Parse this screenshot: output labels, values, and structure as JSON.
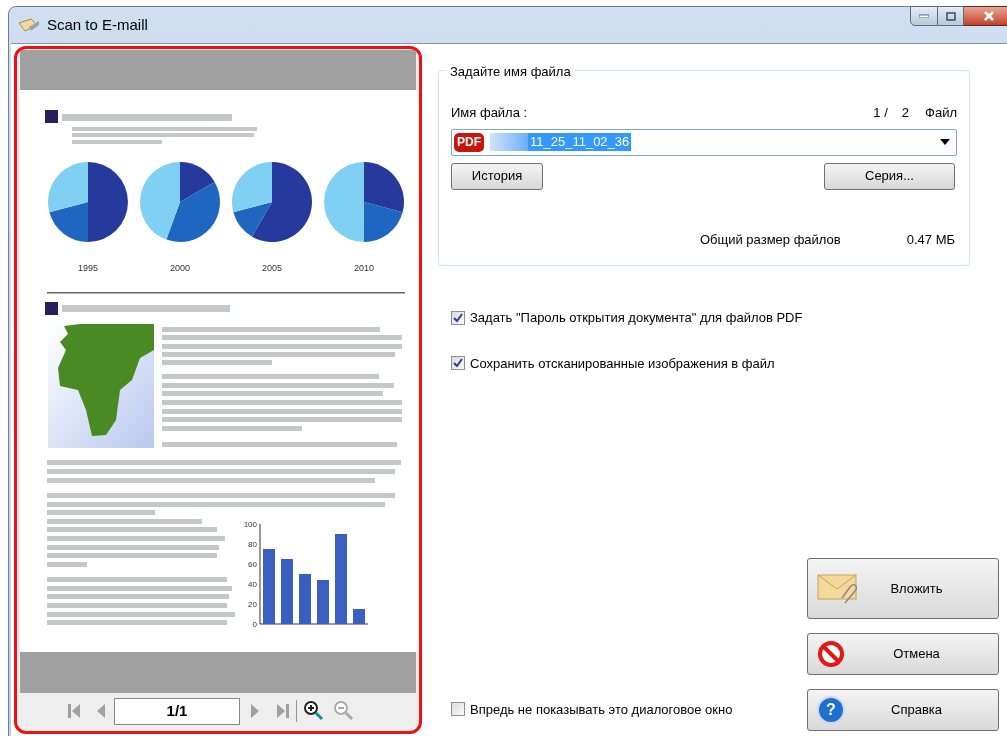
{
  "window": {
    "title": "Scan to E-maill"
  },
  "preview": {
    "pie_labels": [
      "1995",
      "2000",
      "2005",
      "2010"
    ],
    "chart_data": {
      "type": "bar",
      "values": [
        75,
        65,
        50,
        44,
        90,
        15
      ],
      "ylim": [
        0,
        100
      ],
      "yticks": [
        0,
        20,
        40,
        60,
        80,
        100
      ]
    },
    "page_indicator": "1/1"
  },
  "file_group": {
    "title": "Задайте имя файла",
    "filename_label": "Имя файла :",
    "page_current": "1 /",
    "page_total": "2",
    "page_unit": "Файл",
    "file_type_badge": "PDF",
    "filename_value": "11_25_11_02_36",
    "history_button": "История",
    "series_button": "Серия...",
    "total_size_label": "Общий размер файлов",
    "total_size_value": "0.47 МБ"
  },
  "options": [
    {
      "label": "Задать \"Пароль открытия документа\" для файлов PDF",
      "checked": true
    },
    {
      "label": "Сохранить отсканированные изображения в файл",
      "checked": true
    }
  ],
  "dont_show": {
    "label": "Впредь не показывать это диалоговое окно",
    "checked": false
  },
  "buttons": [
    {
      "kind": "attach",
      "label": "Вложить"
    },
    {
      "kind": "cancel",
      "label": "Отмена"
    },
    {
      "kind": "help",
      "label": "Справка",
      "icon_text": "?"
    }
  ]
}
